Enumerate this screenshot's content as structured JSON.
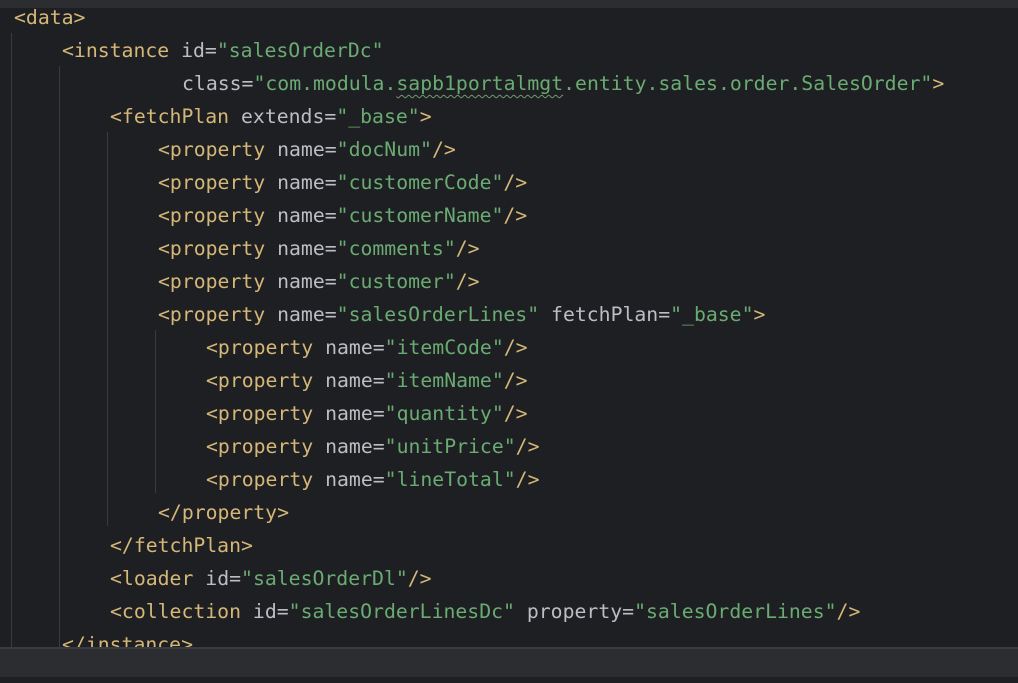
{
  "editor": {
    "lines": [
      {
        "parts": [
          {
            "t": "<data>",
            "c": "tag"
          }
        ]
      },
      {
        "parts": [
          {
            "t": "<instance ",
            "c": "tag"
          },
          {
            "t": "id",
            "c": "attr"
          },
          {
            "t": "=",
            "c": "attr"
          },
          {
            "t": "\"salesOrderDc\"",
            "c": "val"
          }
        ]
      },
      {
        "parts": [
          {
            "t": "class",
            "c": "attr"
          },
          {
            "t": "=",
            "c": "attr"
          },
          {
            "t": "\"com.modula.",
            "c": "val"
          },
          {
            "t": "sapb1portalmgt",
            "c": "val squiggle"
          },
          {
            "t": ".entity.sales.order.SalesOrder\"",
            "c": "val"
          },
          {
            "t": ">",
            "c": "tag"
          }
        ]
      },
      {
        "parts": [
          {
            "t": "<fetchPlan ",
            "c": "tag"
          },
          {
            "t": "extends",
            "c": "attr"
          },
          {
            "t": "=",
            "c": "attr"
          },
          {
            "t": "\"_base\"",
            "c": "val"
          },
          {
            "t": ">",
            "c": "tag"
          }
        ]
      },
      {
        "parts": [
          {
            "t": "<property ",
            "c": "tag"
          },
          {
            "t": "name",
            "c": "attr"
          },
          {
            "t": "=",
            "c": "attr"
          },
          {
            "t": "\"docNum\"",
            "c": "val"
          },
          {
            "t": "/>",
            "c": "tag"
          }
        ]
      },
      {
        "parts": [
          {
            "t": "<property ",
            "c": "tag"
          },
          {
            "t": "name",
            "c": "attr"
          },
          {
            "t": "=",
            "c": "attr"
          },
          {
            "t": "\"customerCode\"",
            "c": "val"
          },
          {
            "t": "/>",
            "c": "tag"
          }
        ]
      },
      {
        "parts": [
          {
            "t": "<property ",
            "c": "tag"
          },
          {
            "t": "name",
            "c": "attr"
          },
          {
            "t": "=",
            "c": "attr"
          },
          {
            "t": "\"customerName\"",
            "c": "val"
          },
          {
            "t": "/>",
            "c": "tag"
          }
        ]
      },
      {
        "parts": [
          {
            "t": "<property ",
            "c": "tag"
          },
          {
            "t": "name",
            "c": "attr"
          },
          {
            "t": "=",
            "c": "attr"
          },
          {
            "t": "\"comments\"",
            "c": "val"
          },
          {
            "t": "/>",
            "c": "tag"
          }
        ]
      },
      {
        "parts": [
          {
            "t": "<property ",
            "c": "tag"
          },
          {
            "t": "name",
            "c": "attr"
          },
          {
            "t": "=",
            "c": "attr"
          },
          {
            "t": "\"customer\"",
            "c": "val"
          },
          {
            "t": "/>",
            "c": "tag"
          }
        ]
      },
      {
        "parts": [
          {
            "t": "<property ",
            "c": "tag"
          },
          {
            "t": "name",
            "c": "attr"
          },
          {
            "t": "=",
            "c": "attr"
          },
          {
            "t": "\"salesOrderLines\"",
            "c": "val"
          },
          {
            "t": " fetchPlan",
            "c": "attr"
          },
          {
            "t": "=",
            "c": "attr"
          },
          {
            "t": "\"_base\"",
            "c": "val"
          },
          {
            "t": ">",
            "c": "tag"
          }
        ]
      },
      {
        "parts": [
          {
            "t": "<property ",
            "c": "tag"
          },
          {
            "t": "name",
            "c": "attr"
          },
          {
            "t": "=",
            "c": "attr"
          },
          {
            "t": "\"itemCode\"",
            "c": "val"
          },
          {
            "t": "/>",
            "c": "tag"
          }
        ]
      },
      {
        "parts": [
          {
            "t": "<property ",
            "c": "tag"
          },
          {
            "t": "name",
            "c": "attr"
          },
          {
            "t": "=",
            "c": "attr"
          },
          {
            "t": "\"itemName\"",
            "c": "val"
          },
          {
            "t": "/>",
            "c": "tag"
          }
        ]
      },
      {
        "parts": [
          {
            "t": "<property ",
            "c": "tag"
          },
          {
            "t": "name",
            "c": "attr"
          },
          {
            "t": "=",
            "c": "attr"
          },
          {
            "t": "\"quantity\"",
            "c": "val"
          },
          {
            "t": "/>",
            "c": "tag"
          }
        ]
      },
      {
        "parts": [
          {
            "t": "<property ",
            "c": "tag"
          },
          {
            "t": "name",
            "c": "attr"
          },
          {
            "t": "=",
            "c": "attr"
          },
          {
            "t": "\"unitPrice\"",
            "c": "val"
          },
          {
            "t": "/>",
            "c": "tag"
          }
        ]
      },
      {
        "parts": [
          {
            "t": "<property ",
            "c": "tag"
          },
          {
            "t": "name",
            "c": "attr"
          },
          {
            "t": "=",
            "c": "attr"
          },
          {
            "t": "\"lineTotal\"",
            "c": "val"
          },
          {
            "t": "/>",
            "c": "tag"
          }
        ]
      },
      {
        "parts": [
          {
            "t": "</property>",
            "c": "tag"
          }
        ]
      },
      {
        "parts": [
          {
            "t": "</fetchPlan>",
            "c": "tag"
          }
        ]
      },
      {
        "parts": [
          {
            "t": "<loader ",
            "c": "tag"
          },
          {
            "t": "id",
            "c": "attr"
          },
          {
            "t": "=",
            "c": "attr"
          },
          {
            "t": "\"salesOrderDl\"",
            "c": "val"
          },
          {
            "t": "/>",
            "c": "tag"
          }
        ]
      },
      {
        "parts": [
          {
            "t": "<collection ",
            "c": "tag"
          },
          {
            "t": "id",
            "c": "attr"
          },
          {
            "t": "=",
            "c": "attr"
          },
          {
            "t": "\"salesOrderLinesDc\"",
            "c": "val"
          },
          {
            "t": " property",
            "c": "attr"
          },
          {
            "t": "=",
            "c": "attr"
          },
          {
            "t": "\"salesOrderLines\"",
            "c": "val"
          },
          {
            "t": "/>",
            "c": "tag"
          }
        ]
      },
      {
        "parts": [
          {
            "t": "</instance>",
            "c": "tag"
          }
        ]
      }
    ]
  },
  "colors": {
    "background": "#1e1f22",
    "tag": "#d5b778",
    "attribute": "#bcbec4",
    "value": "#6aab73",
    "indent_guide": "#393b40"
  }
}
